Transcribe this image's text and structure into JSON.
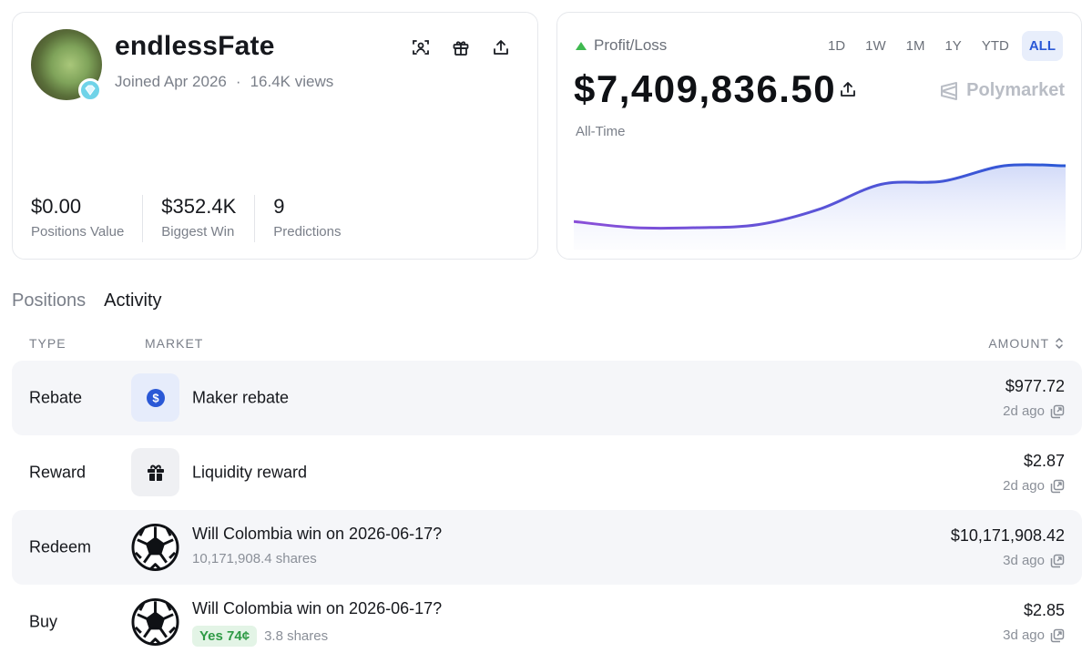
{
  "profile": {
    "username": "endlessFate",
    "joined": "Joined Apr 2026",
    "views": "16.4K views",
    "separator": "·",
    "stats": [
      {
        "value": "$0.00",
        "label": "Positions Value"
      },
      {
        "value": "$352.4K",
        "label": "Biggest Win"
      },
      {
        "value": "9",
        "label": "Predictions"
      }
    ]
  },
  "pnl": {
    "title": "Profit/Loss",
    "ranges": [
      "1D",
      "1W",
      "1M",
      "1Y",
      "YTD",
      "ALL"
    ],
    "active_range": "ALL",
    "value": "$7,409,836.50",
    "brand": "Polymarket",
    "period": "All-Time",
    "colors": {
      "line_start": "#8a4fd8",
      "line_end": "#2a58d6",
      "up": "#3fb950"
    }
  },
  "chart_data": {
    "type": "area",
    "values": [
      0.1,
      0.0,
      0.0,
      0.05,
      0.3,
      0.7,
      0.75,
      1.0,
      1.0
    ],
    "grid": false
  },
  "tabs": [
    "Positions",
    "Activity"
  ],
  "active_tab": "Activity",
  "table": {
    "headers": {
      "type": "TYPE",
      "market": "MARKET",
      "amount": "AMOUNT"
    },
    "rows": [
      {
        "type": "Rebate",
        "icon": "dollar-coin-icon",
        "market": "Maker rebate",
        "sub": "",
        "pill": "",
        "amount": "$977.72",
        "time": "2d ago"
      },
      {
        "type": "Reward",
        "icon": "gift-icon",
        "market": "Liquidity reward",
        "sub": "",
        "pill": "",
        "amount": "$2.87",
        "time": "2d ago"
      },
      {
        "type": "Redeem",
        "icon": "soccer-ball-icon",
        "market": "Will Colombia win on 2026-06-17?",
        "sub": "10,171,908.4 shares",
        "pill": "",
        "amount": "$10,171,908.42",
        "time": "3d ago"
      },
      {
        "type": "Buy",
        "icon": "soccer-ball-icon",
        "market": "Will Colombia win on 2026-06-17?",
        "sub": "3.8 shares",
        "pill": "Yes 74¢",
        "amount": "$2.85",
        "time": "3d ago"
      }
    ]
  }
}
